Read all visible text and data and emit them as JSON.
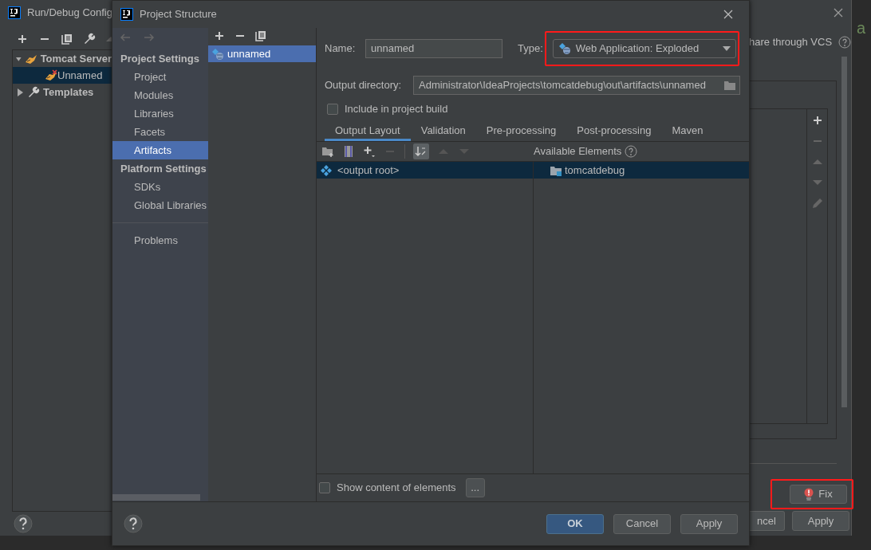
{
  "background_window": {
    "title": "Run/Debug Config",
    "editor_text": "a",
    "tree": [
      {
        "label": "Tomcat Server",
        "expanded": true,
        "selected": false,
        "children": [
          {
            "label": "Unnamed",
            "selected": true
          }
        ]
      },
      {
        "label": "Templates",
        "expanded": false,
        "selected": false
      }
    ],
    "share_label": "hare through VCS",
    "fix_button": {
      "label": "Fix",
      "highlighted": true
    },
    "buttons": [
      {
        "label": "ncel"
      },
      {
        "label": "Apply"
      }
    ]
  },
  "dialog": {
    "title": "Project Structure",
    "sidebar": [
      {
        "kind": "header",
        "label": "Project Settings"
      },
      {
        "kind": "item",
        "label": "Project",
        "selected": false
      },
      {
        "kind": "item",
        "label": "Modules",
        "selected": false
      },
      {
        "kind": "item",
        "label": "Libraries",
        "selected": false
      },
      {
        "kind": "item",
        "label": "Facets",
        "selected": false
      },
      {
        "kind": "item",
        "label": "Artifacts",
        "selected": true
      },
      {
        "kind": "header",
        "label": "Platform Settings"
      },
      {
        "kind": "item",
        "label": "SDKs",
        "selected": false
      },
      {
        "kind": "item",
        "label": "Global Libraries",
        "selected": false
      },
      {
        "kind": "separator"
      },
      {
        "kind": "item",
        "label": "Problems",
        "selected": false
      }
    ],
    "artifacts": [
      {
        "label": "unnamed",
        "selected": true
      }
    ],
    "name_field": {
      "label": "Name:",
      "value": "unnamed"
    },
    "type_field": {
      "label": "Type:",
      "value": "Web Application: Exploded",
      "highlighted": true
    },
    "output_directory": {
      "label": "Output directory:",
      "value": "Administrator\\IdeaProjects\\tomcatdebug\\out\\artifacts\\unnamed"
    },
    "include_in_build": {
      "label": "Include in project build",
      "checked": false
    },
    "tabs": [
      {
        "label": "Output Layout",
        "selected": true
      },
      {
        "label": "Validation",
        "selected": false
      },
      {
        "label": "Pre-processing",
        "selected": false
      },
      {
        "label": "Post-processing",
        "selected": false
      },
      {
        "label": "Maven",
        "selected": false
      }
    ],
    "available_label": "Available Elements",
    "layout_rows": [
      {
        "output": "<output root>",
        "available": "tomcatdebug",
        "selected": true
      }
    ],
    "show_content": {
      "label": "Show content of elements",
      "checked": false
    },
    "more_button": "...",
    "buttons": [
      {
        "label": "OK",
        "kind": "primary"
      },
      {
        "label": "Cancel",
        "kind": "default"
      },
      {
        "label": "Apply",
        "kind": "default"
      }
    ]
  }
}
